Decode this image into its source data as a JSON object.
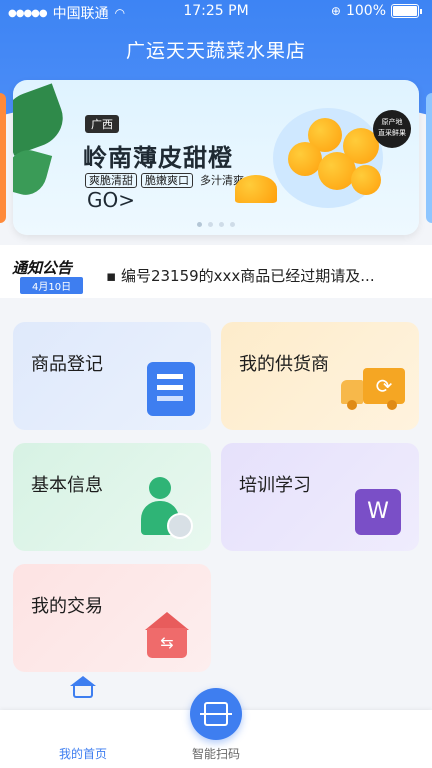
{
  "status_bar": {
    "carrier": "中国联通",
    "time": "17:25 PM",
    "battery": "100%"
  },
  "app": {
    "title": "广运天天蔬菜水果店"
  },
  "banner": {
    "tag": "广西",
    "title": "岭南薄皮甜橙",
    "features": [
      "爽脆清甜",
      "脆嫩爽口",
      "多汁清爽"
    ],
    "go": "GO>",
    "badge_lines": [
      "原产地",
      "直采鲜果"
    ]
  },
  "notice": {
    "title": "通知公告",
    "date": "4月10日",
    "text": "编号23159的xxx商品已经过期请及..."
  },
  "cards": [
    {
      "label": "商品登记"
    },
    {
      "label": "我的供货商"
    },
    {
      "label": "基本信息"
    },
    {
      "label": "培训学习"
    },
    {
      "label": "我的交易"
    }
  ],
  "tabbar": {
    "home": "我的首页",
    "scan": "智能扫码"
  },
  "colors": {
    "primary": "#3e7ef0"
  }
}
